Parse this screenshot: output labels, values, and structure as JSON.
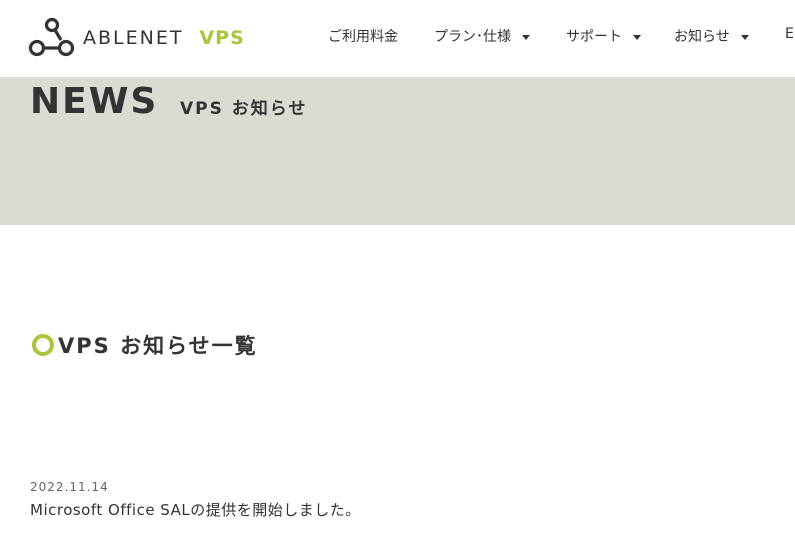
{
  "header": {
    "logo_text": "ABLENET",
    "logo_vps": "VPS",
    "nav": [
      {
        "label": "ご利用料金"
      },
      {
        "label": "プラン･仕様"
      },
      {
        "label": "サポート"
      },
      {
        "label": "お知らせ"
      },
      {
        "label": "E"
      }
    ]
  },
  "hero": {
    "title": "NEWS",
    "subtitle": "VPS お知らせ"
  },
  "section": {
    "title": "VPS お知らせ一覧"
  },
  "news": [
    {
      "date": "2022.11.14",
      "title": "Microsoft Office SALの提供を開始しました。"
    }
  ],
  "colors": {
    "accent": "#a8c63a",
    "hero_bg": "#dadcd3",
    "text": "#333333"
  },
  "icons": {
    "logo": "ablenet-logo-icon",
    "dropdown": "caret-down-icon",
    "section_marker": "ring-icon"
  }
}
